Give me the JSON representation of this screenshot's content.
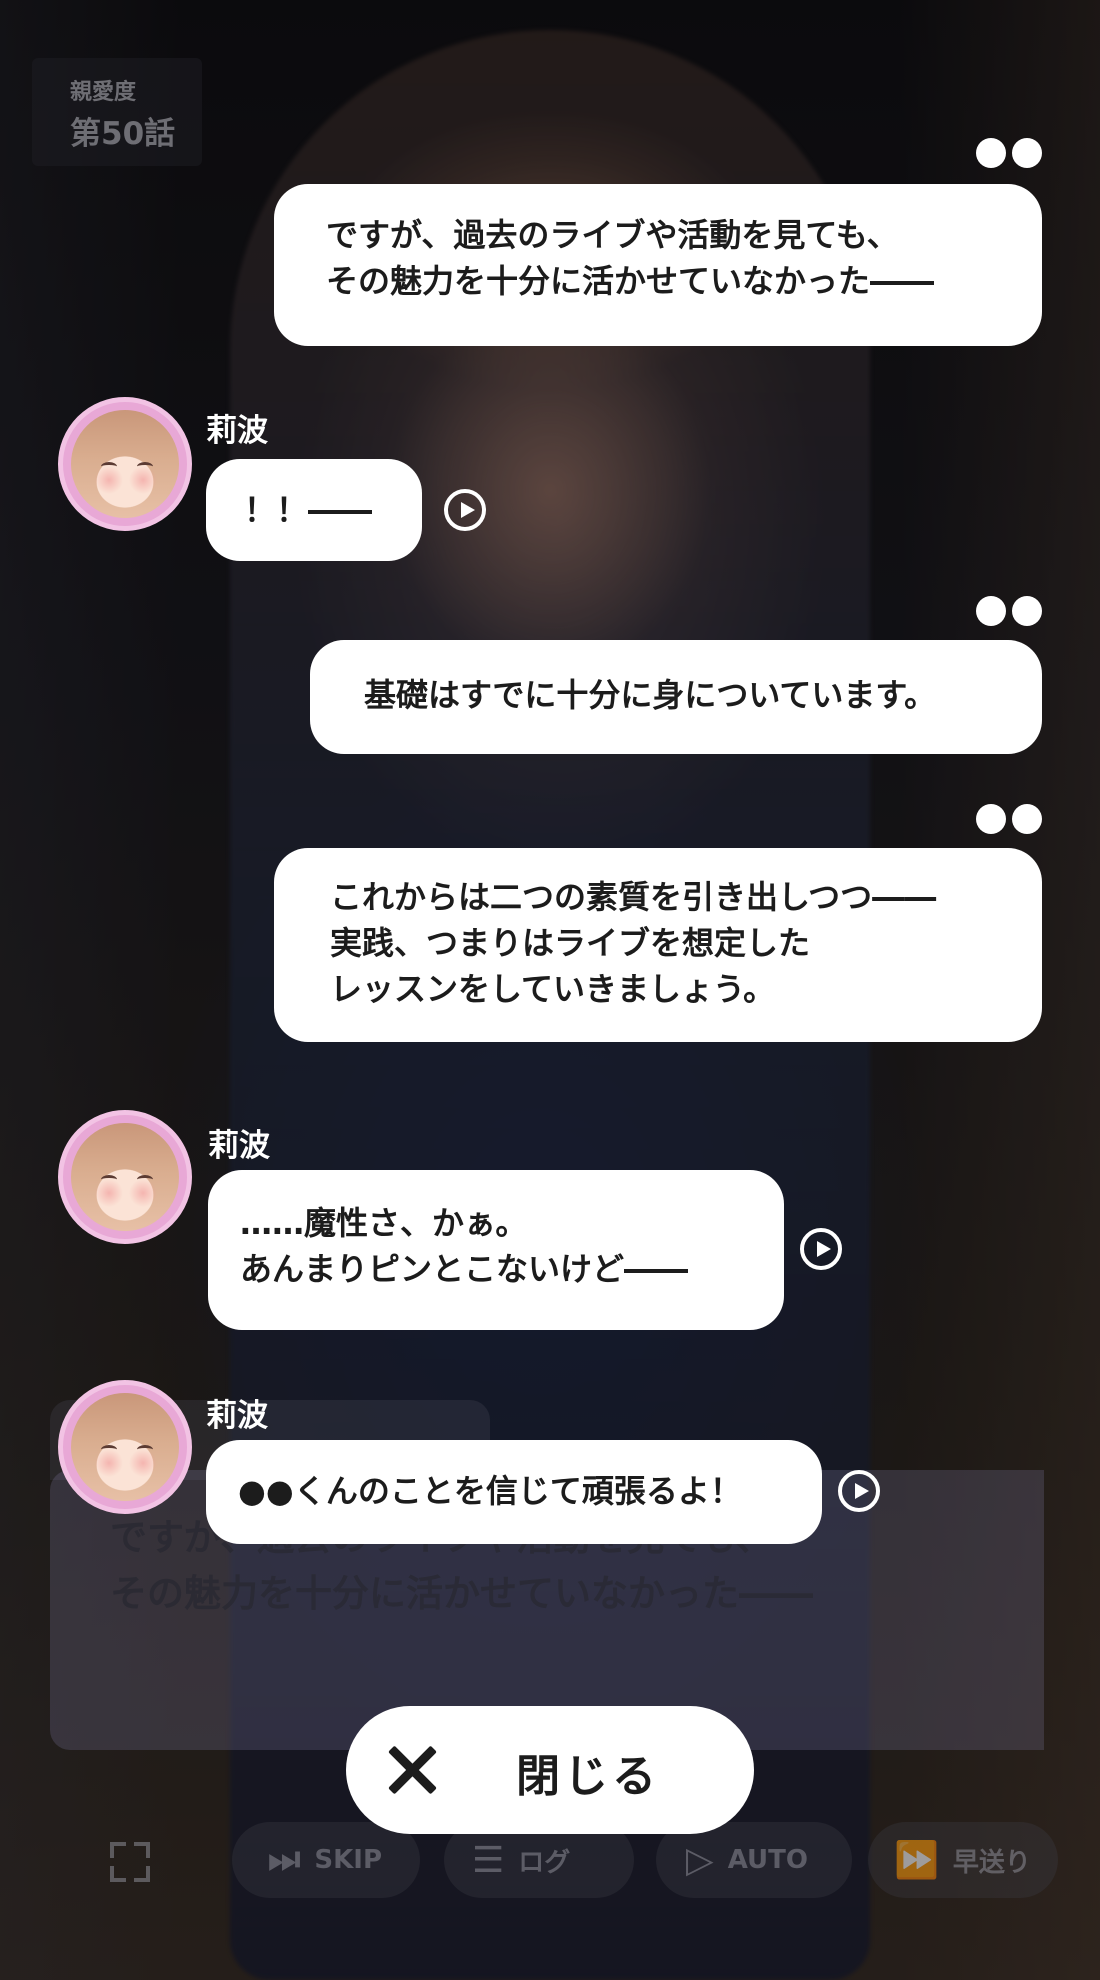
{
  "chapter": {
    "label": "親愛度",
    "title": "第50話"
  },
  "log": [
    {
      "speaker": "",
      "lines": [
        "ですが、過去のライブや活動を見ても、",
        "その魅力を十分に活かせていなかった――"
      ]
    },
    {
      "speaker": "莉波",
      "lines": [
        "！！――"
      ]
    },
    {
      "speaker": "",
      "lines": [
        "基礎はすでに十分に身についています。"
      ]
    },
    {
      "speaker": "",
      "lines": [
        "これからは二つの素質を引き出しつつ――",
        "実践、つまりはライブを想定した",
        "レッスンをしていきましょう。"
      ]
    },
    {
      "speaker": "莉波",
      "lines": [
        "……魔性さ、かぁ。",
        "あんまりピンとこないけど――"
      ]
    },
    {
      "speaker": "莉波",
      "lines": [
        "●●くんのことを信じて頑張るよ！"
      ]
    }
  ],
  "dialog_window": {
    "lines": [
      "ですが、過去のライブや活動を見ても、",
      "その魅力を十分に活かせていなかった――"
    ]
  },
  "close_button": {
    "label": "閉じる"
  },
  "toolbar": {
    "skip": "SKIP",
    "log": "ログ",
    "auto": "AUTO",
    "fast_forward": "早送り"
  }
}
